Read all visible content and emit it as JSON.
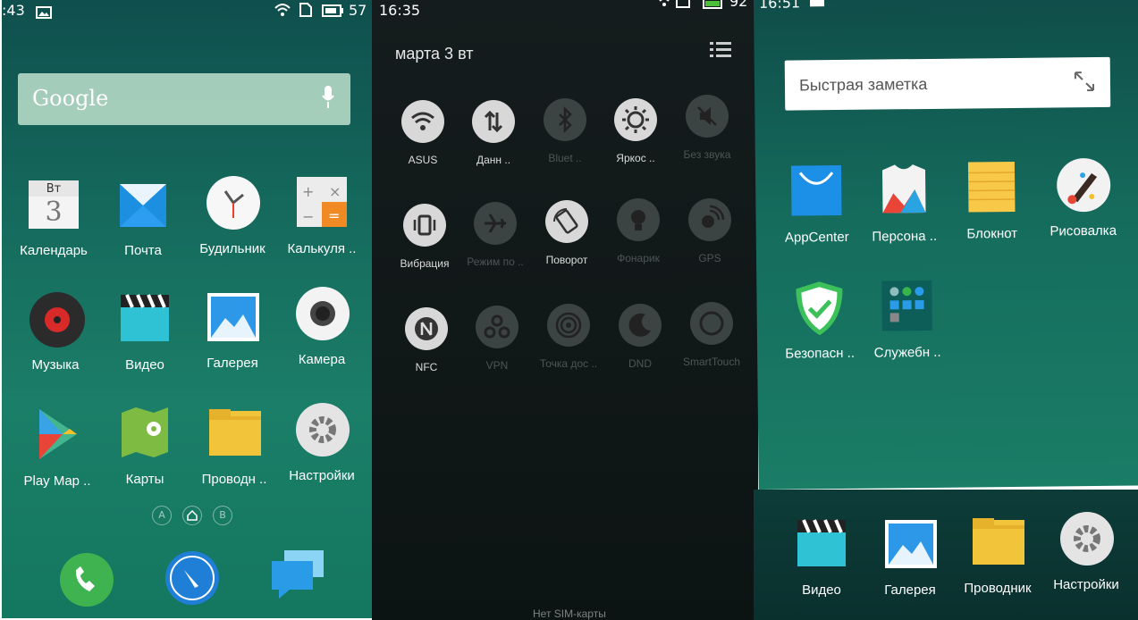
{
  "left_screen": {
    "status": {
      "time": ":43",
      "battery": "57"
    },
    "google": {
      "logo": "Google",
      "icon": "mic-icon"
    },
    "apps": [
      {
        "label": "Календарь",
        "icon": "calendar-icon",
        "badge": "Вт",
        "day": "3"
      },
      {
        "label": "Почта",
        "icon": "mail-icon"
      },
      {
        "label": "Будильник",
        "icon": "clock-icon"
      },
      {
        "label": "Калькуля ..",
        "icon": "calculator-icon"
      },
      {
        "label": "Музыка",
        "icon": "music-icon"
      },
      {
        "label": "Видео",
        "icon": "video-icon"
      },
      {
        "label": "Галерея",
        "icon": "gallery-icon"
      },
      {
        "label": "Камера",
        "icon": "camera-icon"
      },
      {
        "label": "Play Map ..",
        "icon": "play-store-icon"
      },
      {
        "label": "Карты",
        "icon": "maps-icon"
      },
      {
        "label": "Проводн ..",
        "icon": "folder-icon"
      },
      {
        "label": "Настройки",
        "icon": "settings-icon"
      }
    ],
    "pager": {
      "a": "A",
      "b": "B"
    },
    "dock": [
      "phone-icon",
      "browser-icon",
      "messages-icon"
    ]
  },
  "middle_screen": {
    "status": {
      "time": "16:35",
      "battery": "92"
    },
    "date": "марта 3  вт",
    "tiles": [
      {
        "label": "ASUS",
        "icon": "wifi-icon",
        "on": true
      },
      {
        "label": "Данн ..",
        "icon": "data-icon",
        "on": true
      },
      {
        "label": "Bluet ..",
        "icon": "bluetooth-icon",
        "on": false
      },
      {
        "label": "Яркос ..",
        "icon": "brightness-icon",
        "on": true
      },
      {
        "label": "Без звука",
        "icon": "mute-icon",
        "on": false
      },
      {
        "label": "Вибрация",
        "icon": "vibration-icon",
        "on": true
      },
      {
        "label": "Режим по ..",
        "icon": "airplane-icon",
        "on": false
      },
      {
        "label": "Поворот",
        "icon": "rotate-icon",
        "on": true
      },
      {
        "label": "Фонарик",
        "icon": "flashlight-icon",
        "on": false
      },
      {
        "label": "GPS",
        "icon": "gps-icon",
        "on": false
      },
      {
        "label": "NFC",
        "icon": "nfc-icon",
        "on": true
      },
      {
        "label": "VPN",
        "icon": "vpn-icon",
        "on": false
      },
      {
        "label": "Точка дос ..",
        "icon": "hotspot-icon",
        "on": false
      },
      {
        "label": "DND",
        "icon": "moon-icon",
        "on": false
      },
      {
        "label": "SmartTouch",
        "icon": "smarttouch-icon",
        "on": false
      }
    ],
    "footer": "Нет SIM-карты"
  },
  "right_screen": {
    "status": {
      "time": "16:51"
    },
    "note": {
      "title": "Быстрая заметка",
      "icon": "expand-icon"
    },
    "apps": [
      {
        "label": "AppCenter",
        "icon": "appcenter-icon"
      },
      {
        "label": "Персона ..",
        "icon": "theme-icon"
      },
      {
        "label": "Блокнот",
        "icon": "notepad-icon"
      },
      {
        "label": "Рисовалка",
        "icon": "paint-icon"
      },
      {
        "label": "Безопасн ..",
        "icon": "security-icon"
      },
      {
        "label": "Служебн ..",
        "icon": "tools-folder-icon"
      }
    ],
    "dock": [
      {
        "label": "Видео",
        "icon": "video-icon"
      },
      {
        "label": "Галерея",
        "icon": "gallery-icon"
      },
      {
        "label": "Проводник",
        "icon": "folder-icon"
      },
      {
        "label": "Настройки",
        "icon": "settings-icon"
      }
    ]
  },
  "colors": {
    "accent_green": "#36b54a",
    "accent_blue": "#2b8fe8",
    "accent_orange": "#f08a24"
  }
}
